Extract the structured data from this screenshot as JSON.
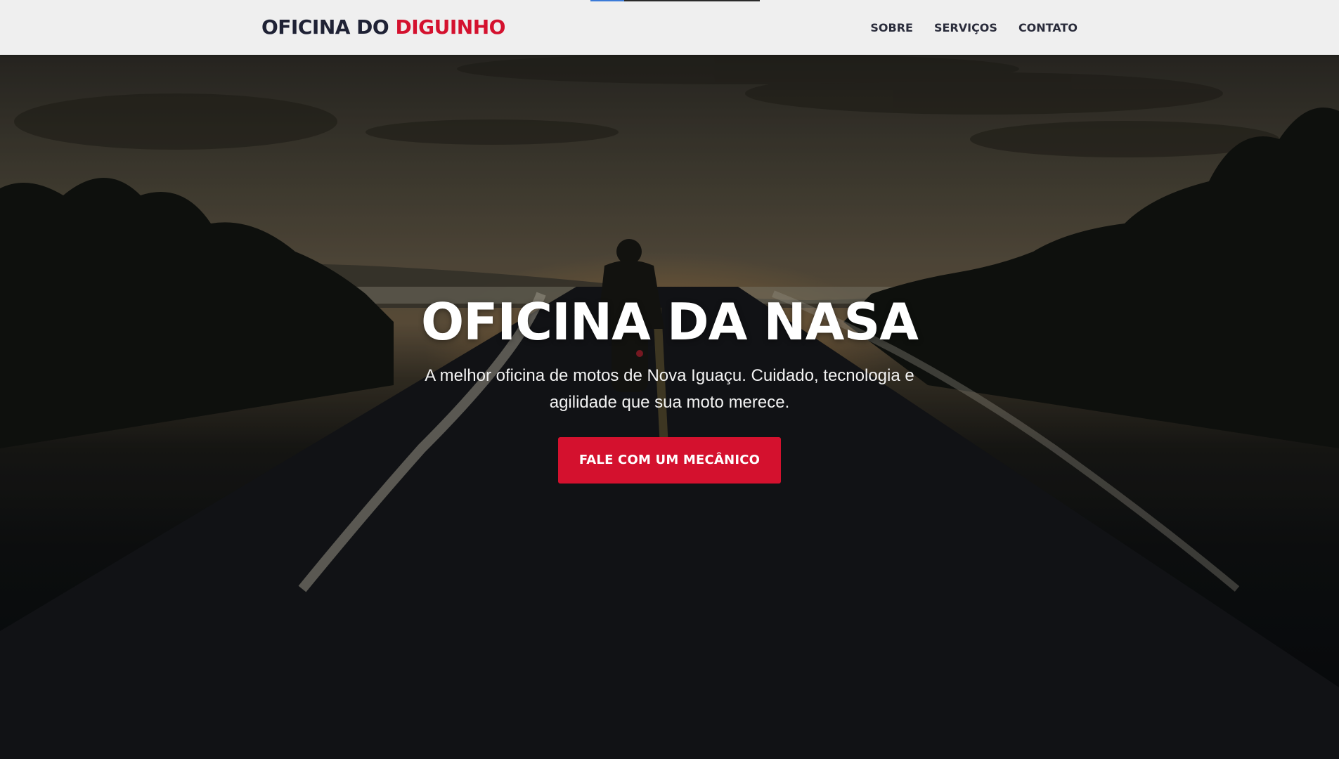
{
  "brand": {
    "part1": "OFICINA DO",
    "part2": "DIGUINHO"
  },
  "nav": {
    "items": [
      "SOBRE",
      "SERVIÇOS",
      "CONTATO"
    ]
  },
  "hero": {
    "title": "OFICINA DA NASA",
    "subtitle": "A melhor oficina de motos de Nova Iguaçu. Cuidado, tecnologia e agilidade que sua moto merece.",
    "cta": "FALE COM UM MECÂNICO"
  },
  "colors": {
    "accent": "#d4112e",
    "navbar": "#efefef",
    "text_dark": "#1f2235"
  }
}
